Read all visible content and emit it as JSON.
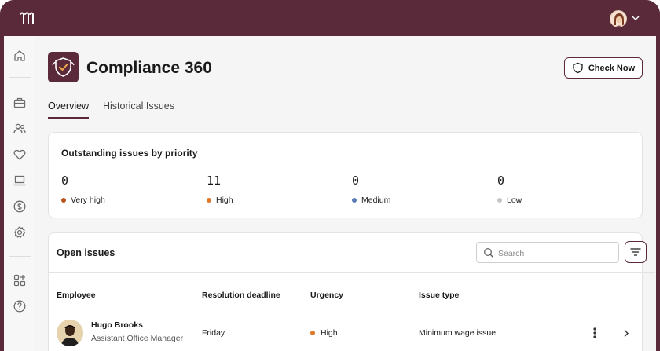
{
  "page": {
    "title": "Compliance 360",
    "check_now_label": "Check Now"
  },
  "tabs": [
    {
      "label": "Overview",
      "active": true
    },
    {
      "label": "Historical Issues",
      "active": false
    }
  ],
  "priority": {
    "title": "Outstanding issues by priority",
    "stats": [
      {
        "value": "0",
        "label": "Very high",
        "color": "#b5541c"
      },
      {
        "value": "11",
        "label": "High",
        "color": "#e0782a"
      },
      {
        "value": "0",
        "label": "Medium",
        "color": "#5a7bb5"
      },
      {
        "value": "0",
        "label": "Low",
        "color": "#c4c4c4"
      }
    ]
  },
  "open_issues": {
    "title": "Open issues",
    "search_placeholder": "Search",
    "columns": [
      "Employee",
      "Resolution deadline",
      "Urgency",
      "Issue type"
    ],
    "rows": [
      {
        "name": "Hugo Brooks",
        "role": "Assistant Office Manager",
        "deadline": "Friday",
        "urgency": "High",
        "urgency_color": "#e0782a",
        "issue_type": "Minimum wage issue"
      }
    ]
  },
  "sidebar": {
    "icons": [
      "home-icon",
      "briefcase-icon",
      "people-icon",
      "heart-icon",
      "laptop-icon",
      "dollar-icon",
      "settings-icon",
      "apps-add-icon",
      "help-icon"
    ]
  }
}
